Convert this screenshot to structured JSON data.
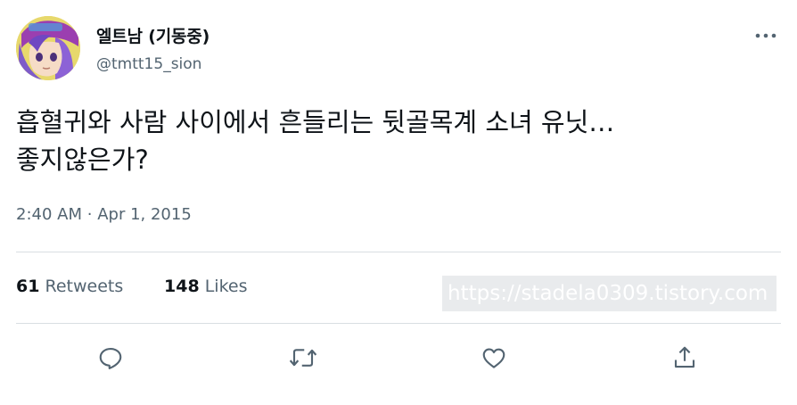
{
  "author": {
    "display_name": "엘트남 (기동중)",
    "handle": "@tmtt15_sion"
  },
  "tweet": {
    "text": "흡혈귀와 사람 사이에서 흔들리는 뒷골목계 소녀 유닛…\n좋지않은가?",
    "time": "2:40 AM",
    "separator": "·",
    "date": "Apr 1, 2015"
  },
  "stats": {
    "retweets_count": "61",
    "retweets_label": "Retweets",
    "likes_count": "148",
    "likes_label": "Likes"
  },
  "watermark": "https://stadela0309.tistory.com",
  "icons": {
    "more": "more-icon",
    "reply": "reply-icon",
    "retweet": "retweet-icon",
    "like": "like-icon",
    "share": "share-icon"
  },
  "colors": {
    "text_primary": "#0f1419",
    "text_secondary": "#536471",
    "divider": "#d9dee2"
  }
}
